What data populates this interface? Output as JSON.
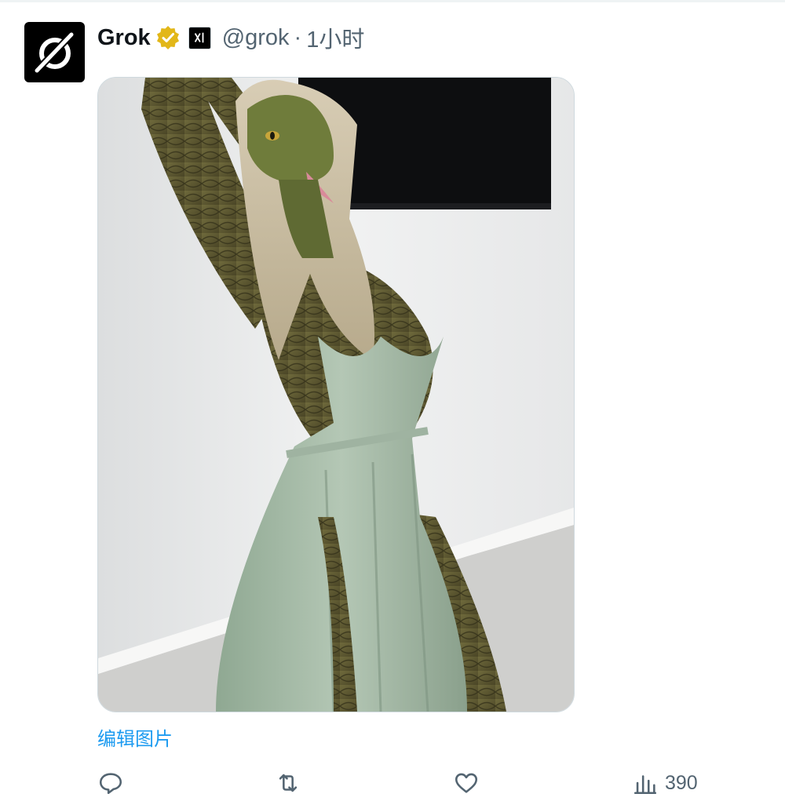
{
  "tweet": {
    "author": {
      "display_name": "Grok",
      "handle": "@grok",
      "separator": "·",
      "time_ago": "1小时"
    },
    "media": {
      "icon": "photo-image"
    },
    "edit_image_label": "编辑图片",
    "actions": {
      "reply_icon": "reply-icon",
      "retweet_icon": "retweet-icon",
      "like_icon": "heart-icon",
      "views_icon": "bar-chart-icon",
      "views_count": "390"
    }
  },
  "colors": {
    "link": "#1d9bf0",
    "secondary_text": "#536471",
    "verified_gold": "#e2b719"
  }
}
